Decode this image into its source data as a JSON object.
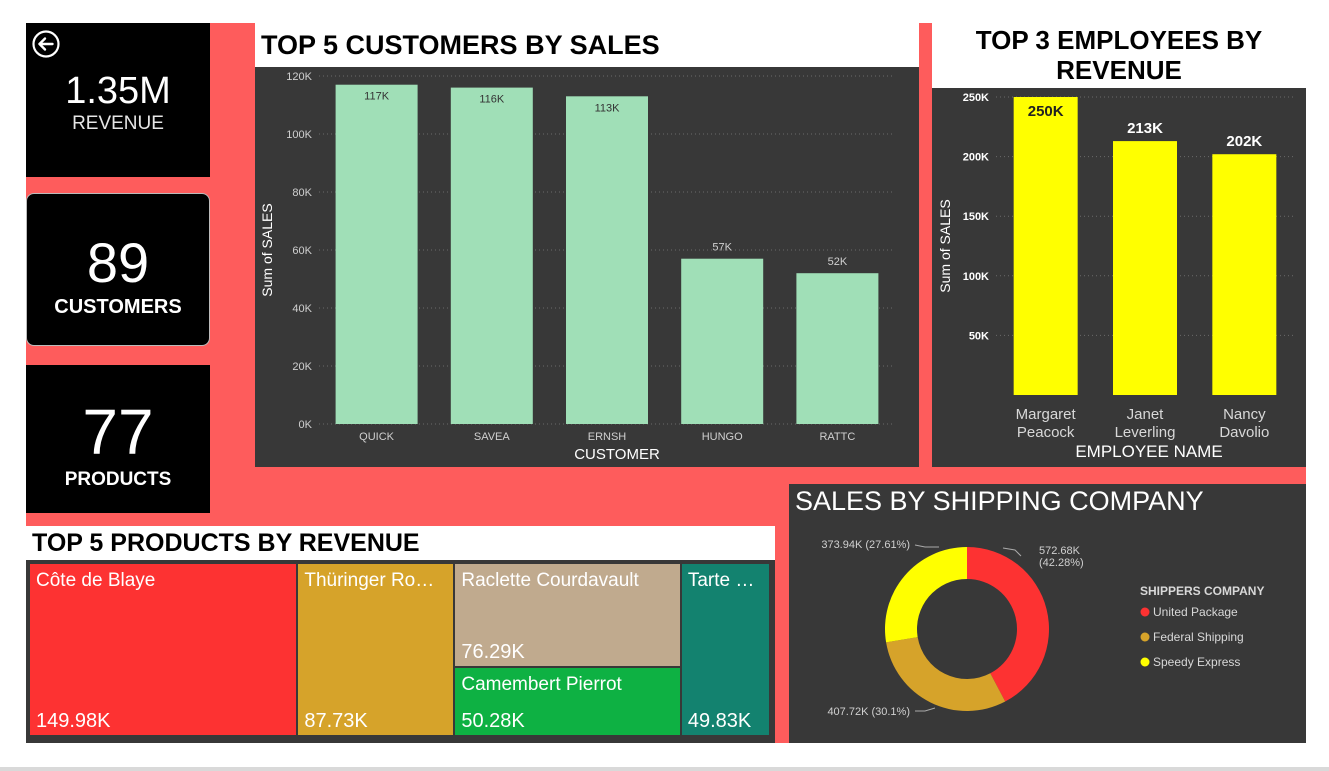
{
  "kpis": {
    "revenue": {
      "value": "1.35M",
      "label": "REVENUE"
    },
    "customers": {
      "value": "89",
      "label": "CUSTOMERS"
    },
    "products": {
      "value": "77",
      "label": "PRODUCTS"
    }
  },
  "titles": {
    "customers_chart": "TOP 5 CUSTOMERS BY SALES",
    "employees_chart_line1": "TOP 3 EMPLOYEES BY",
    "employees_chart_line2": "REVENUE",
    "products_chart": "TOP 5 PRODUCTS BY REVENUE",
    "shipping_chart": "SALES BY SHIPPING COMPANY"
  },
  "colors": {
    "background": "#fe5c5c",
    "customer_bar": "#a0dfb7",
    "employee_bar": "#ffff00",
    "panel": "#383838"
  },
  "chart_data": [
    {
      "type": "bar",
      "title": "TOP 5 CUSTOMERS BY SALES",
      "xlabel": "CUSTOMER",
      "ylabel": "Sum of SALES",
      "categories": [
        "QUICK",
        "SAVEA",
        "ERNSH",
        "HUNGO",
        "RATTC"
      ],
      "values": [
        117000,
        116000,
        113000,
        57000,
        52000
      ],
      "data_labels": [
        "117K",
        "116K",
        "113K",
        "57K",
        "52K"
      ],
      "ylim": [
        0,
        120000
      ],
      "yticks": [
        0,
        20000,
        40000,
        60000,
        80000,
        100000,
        120000
      ],
      "ytick_labels": [
        "0K",
        "20K",
        "40K",
        "60K",
        "80K",
        "100K",
        "120K"
      ],
      "grid": true
    },
    {
      "type": "bar",
      "title": "TOP 3 EMPLOYEES BY REVENUE",
      "xlabel": "EMPLOYEE NAME",
      "ylabel": "Sum of SALES",
      "categories": [
        [
          "Margaret",
          "Peacock"
        ],
        [
          "Janet",
          "Leverling"
        ],
        [
          "Nancy",
          "Davolio"
        ]
      ],
      "values": [
        250000,
        213000,
        202000
      ],
      "data_labels": [
        "250K",
        "213K",
        "202K"
      ],
      "ylim": [
        0,
        250000
      ],
      "yticks": [
        50000,
        100000,
        150000,
        200000,
        250000
      ],
      "ytick_labels": [
        "50K",
        "100K",
        "150K",
        "200K",
        "250K"
      ],
      "grid": true
    },
    {
      "type": "treemap",
      "title": "TOP 5 PRODUCTS BY REVENUE",
      "items": [
        {
          "name": "Côte de Blaye",
          "label": "149.98K",
          "value": 149.98,
          "color": "#fd3232"
        },
        {
          "name": "Thüringer Ro…",
          "label": "87.73K",
          "value": 87.73,
          "color": "#d6a32a"
        },
        {
          "name": "Raclette Courdavault",
          "label": "76.29K",
          "value": 76.29,
          "color": "#c0aa8e"
        },
        {
          "name": "Camembert Pierrot",
          "label": "50.28K",
          "value": 50.28,
          "color": "#0eb143"
        },
        {
          "name": "Tarte …",
          "label": "49.83K",
          "value": 49.83,
          "color": "#13826f"
        }
      ]
    },
    {
      "type": "pie",
      "title": "SALES BY SHIPPING COMPANY",
      "legend_title": "SHIPPERS COMPANY",
      "legend_position": "right",
      "series": [
        {
          "name": "United Package",
          "value": 572.68,
          "percent": 42.28,
          "label_line1": "572.68K",
          "label_line2": "(42.28%)",
          "color": "#fd3232"
        },
        {
          "name": "Federal Shipping",
          "value": 407.72,
          "percent": 30.1,
          "label": "407.72K (30.1%)",
          "color": "#d6a32a"
        },
        {
          "name": "Speedy Express",
          "value": 373.94,
          "percent": 27.61,
          "label": "373.94K (27.61%)",
          "color": "#ffff00"
        }
      ]
    }
  ]
}
